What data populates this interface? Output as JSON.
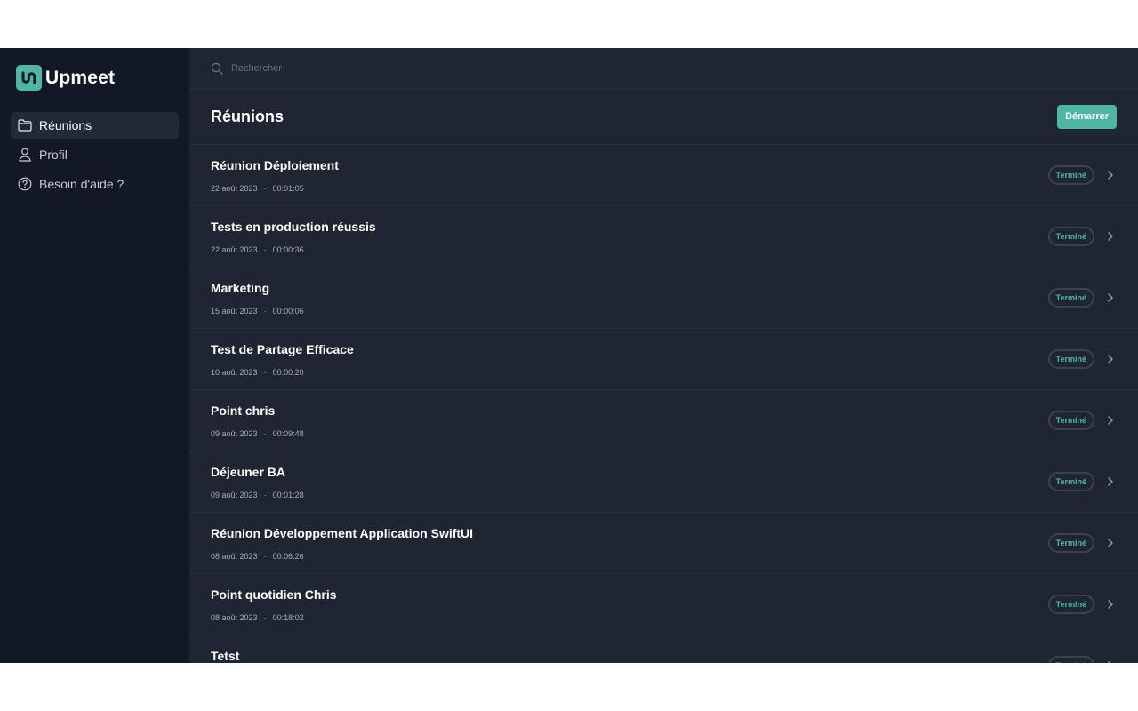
{
  "brand": {
    "name": "Upmeet"
  },
  "sidebar": {
    "items": [
      {
        "label": "Réunions",
        "icon": "folder-icon",
        "active": true
      },
      {
        "label": "Profil",
        "icon": "user-icon",
        "active": false
      },
      {
        "label": "Besoin d'aide ?",
        "icon": "help-circle-icon",
        "active": false
      }
    ]
  },
  "search": {
    "placeholder": "Rechercher",
    "value": ""
  },
  "header": {
    "title": "Réunions",
    "start_label": "Démarrer"
  },
  "meetings": [
    {
      "title": "Réunion Déploiement",
      "date": "22 août 2023",
      "duration": "00:01:05",
      "status": "Terminé"
    },
    {
      "title": "Tests en production réussis",
      "date": "22 août 2023",
      "duration": "00:00:36",
      "status": "Terminé"
    },
    {
      "title": "Marketing",
      "date": "15 août 2023",
      "duration": "00:00:06",
      "status": "Terminé"
    },
    {
      "title": "Test de Partage Efficace",
      "date": "10 août 2023",
      "duration": "00:00:20",
      "status": "Terminé"
    },
    {
      "title": "Point chris",
      "date": "09 août 2023",
      "duration": "00:09:48",
      "status": "Terminé"
    },
    {
      "title": "Déjeuner BA",
      "date": "09 août 2023",
      "duration": "00:01:28",
      "status": "Terminé"
    },
    {
      "title": "Réunion Développement Application SwiftUI",
      "date": "08 août 2023",
      "duration": "00:06:26",
      "status": "Terminé"
    },
    {
      "title": "Point quotidien Chris",
      "date": "08 août 2023",
      "duration": "00:18:02",
      "status": "Terminé"
    },
    {
      "title": "Tetst",
      "date": "",
      "duration": "",
      "status": "Terminé"
    }
  ],
  "colors": {
    "accent": "#4fb6a2",
    "sidebar_bg": "#121826",
    "main_bg": "#1f2532",
    "divider": "#272e3b"
  }
}
